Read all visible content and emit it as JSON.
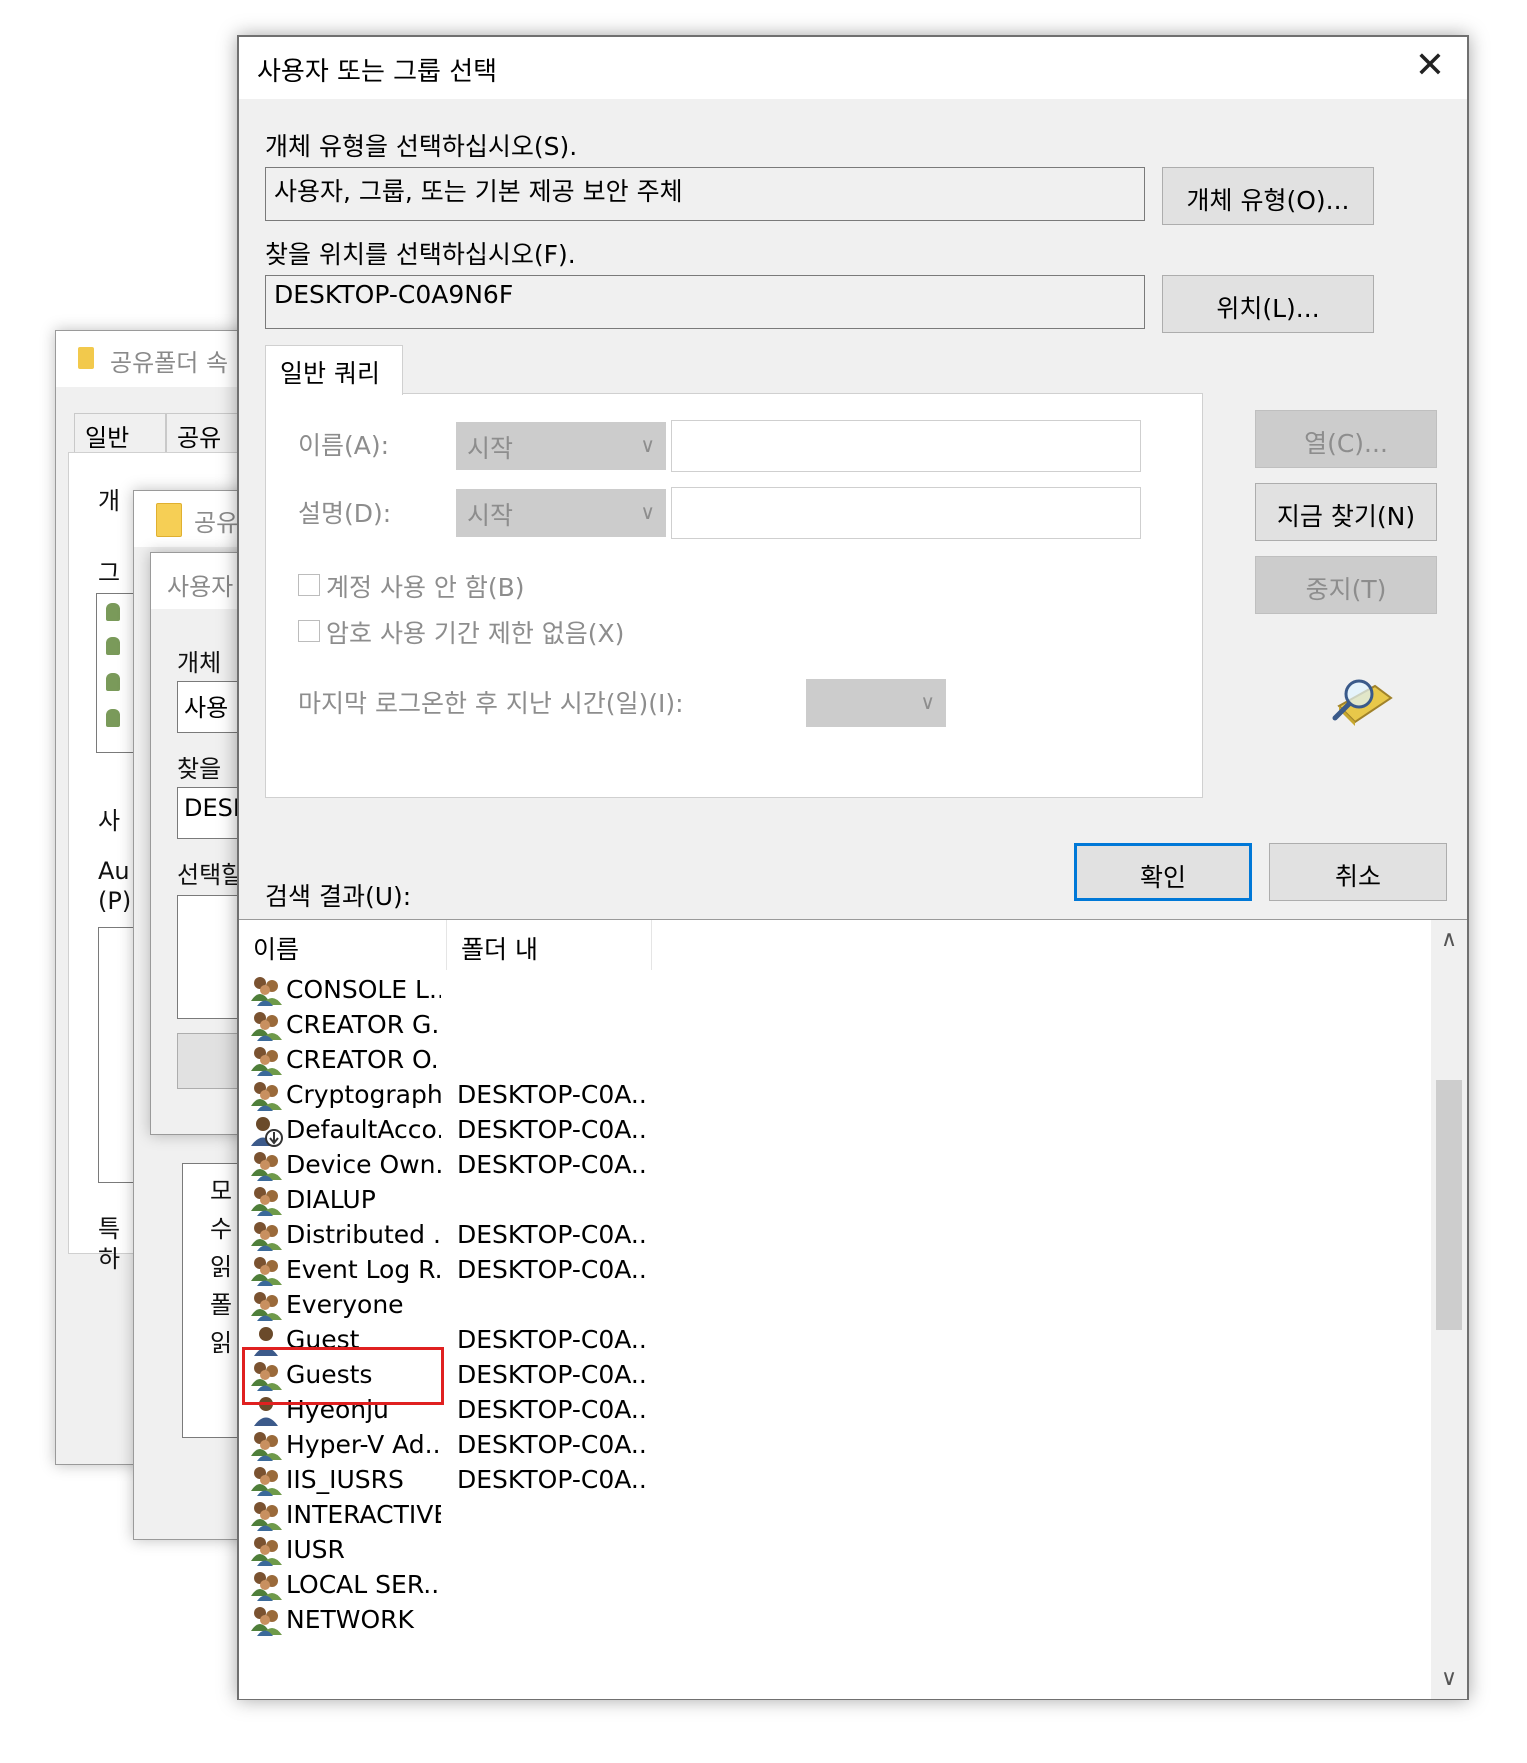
{
  "background_windows": {
    "window1": {
      "title": "공유폴더 속",
      "tabs": [
        "일반",
        "공유"
      ],
      "fragments": [
        "개",
        "그",
        "사",
        "Au",
        "(P)",
        "특",
        "하"
      ]
    },
    "window2": {
      "title": "공유"
    },
    "window3": {
      "title": "사용자",
      "fragments": [
        "개체",
        "사용",
        "찾을",
        "DESK",
        "선택할"
      ],
      "perm_fragments": [
        "모",
        "수",
        "읽",
        "폴",
        "읽"
      ]
    }
  },
  "dialog": {
    "title": "사용자 또는 그룹 선택",
    "close_glyph": "✕",
    "object_type_label": "개체 유형을 선택하십시오(S).",
    "object_type_value": "사용자, 그룹, 또는 기본 제공 보안 주체",
    "object_type_button": "개체 유형(O)...",
    "location_label": "찾을 위치를 선택하십시오(F).",
    "location_value": "DESKTOP-C0A9N6F",
    "location_button": "위치(L)...",
    "query_tab": "일반 쿼리",
    "name_label": "이름(A):",
    "name_combo": "시작",
    "desc_label": "설명(D):",
    "desc_combo": "시작",
    "disabled_accounts": "계정 사용 안 함(B)",
    "no_expire_password": "암호 사용 기간 제한 없음(X)",
    "days_since_logon": "마지막 로그온한 후 지난 시간(일)(I):",
    "columns_button": "열(C)...",
    "find_now_button": "지금 찾기(N)",
    "stop_button": "중지(T)",
    "ok_button": "확인",
    "cancel_button": "취소",
    "results_label": "검색 결과(U):",
    "results_columns": [
      "이름",
      "폴더 내"
    ],
    "results": [
      {
        "name": "CONSOLE L...",
        "folder": "",
        "icon": "group-icon"
      },
      {
        "name": "CREATOR G...",
        "folder": "",
        "icon": "group-icon"
      },
      {
        "name": "CREATOR O...",
        "folder": "",
        "icon": "group-icon"
      },
      {
        "name": "Cryptograph...",
        "folder": "DESKTOP-C0A...",
        "icon": "group-icon"
      },
      {
        "name": "DefaultAcco...",
        "folder": "DESKTOP-C0A...",
        "icon": "user-disabled-icon"
      },
      {
        "name": "Device Own...",
        "folder": "DESKTOP-C0A...",
        "icon": "group-icon"
      },
      {
        "name": "DIALUP",
        "folder": "",
        "icon": "group-icon"
      },
      {
        "name": "Distributed ...",
        "folder": "DESKTOP-C0A...",
        "icon": "group-icon"
      },
      {
        "name": "Event Log R...",
        "folder": "DESKTOP-C0A...",
        "icon": "group-icon"
      },
      {
        "name": "Everyone",
        "folder": "",
        "icon": "group-icon"
      },
      {
        "name": "Guest",
        "folder": "DESKTOP-C0A...",
        "icon": "user-icon"
      },
      {
        "name": "Guests",
        "folder": "DESKTOP-C0A...",
        "icon": "group-icon"
      },
      {
        "name": "Hyeonju",
        "folder": "DESKTOP-C0A...",
        "icon": "user-icon"
      },
      {
        "name": "Hyper-V Ad...",
        "folder": "DESKTOP-C0A...",
        "icon": "group-icon"
      },
      {
        "name": "IIS_IUSRS",
        "folder": "DESKTOP-C0A...",
        "icon": "group-icon"
      },
      {
        "name": "INTERACTIVE",
        "folder": "",
        "icon": "group-icon"
      },
      {
        "name": "IUSR",
        "folder": "",
        "icon": "group-icon"
      },
      {
        "name": "LOCAL SER...",
        "folder": "",
        "icon": "group-icon"
      },
      {
        "name": "NETWORK",
        "folder": "",
        "icon": "group-icon"
      }
    ],
    "selected_highlight": "Everyone",
    "highlight_color": "#e02020",
    "accent_color": "#0078d7"
  }
}
